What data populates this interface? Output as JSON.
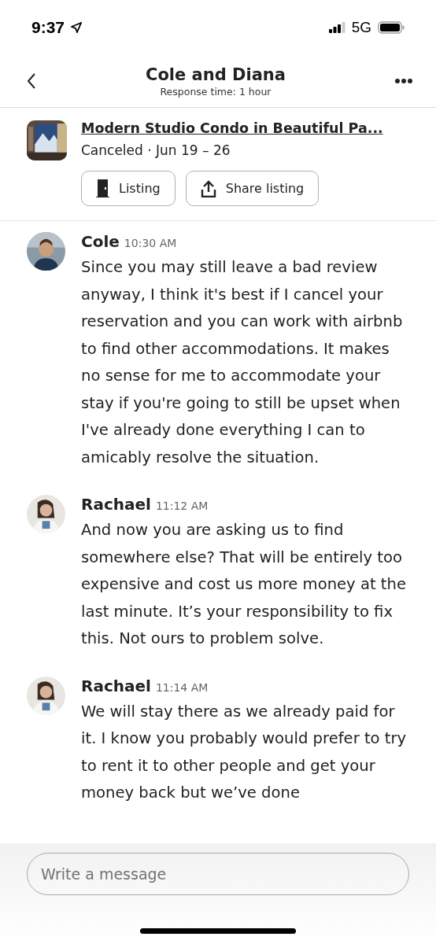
{
  "status_bar": {
    "time": "9:37",
    "network": "5G"
  },
  "header": {
    "title": "Cole and Diana",
    "subtitle": "Response time: 1 hour"
  },
  "listing": {
    "title": "Modern Studio Condo in Beautiful Pa...",
    "status": "Canceled · Jun 19 – 26",
    "buttons": [
      {
        "kind": "door",
        "label": "Listing"
      },
      {
        "kind": "share",
        "label": "Share listing"
      }
    ]
  },
  "messages": [
    {
      "sender": "Cole",
      "time": "10:30 AM",
      "text": "Since you may still leave a bad review anyway,  I think it's best if I cancel your reservation and you can work with airbnb to find other accommodations. It makes no sense for me to accommodate your stay if you're going to still be upset when I've already done everything I can to amicably resolve the situation."
    },
    {
      "sender": "Rachael",
      "time": "11:12 AM",
      "text": "And now you are asking us to find somewhere else? That will be entirely too expensive and cost us more money at the last minute. It’s your responsibility to fix this. Not ours to problem solve."
    },
    {
      "sender": "Rachael",
      "time": "11:14 AM",
      "text": "We will stay there as we already paid for it. I know you probably would prefer to try to rent it to other people and get your money back but we’ve done"
    }
  ],
  "composer": {
    "placeholder": "Write a message"
  }
}
